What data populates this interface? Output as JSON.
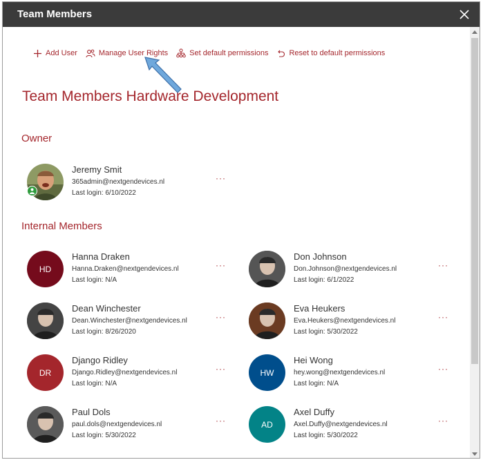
{
  "window": {
    "title": "Team Members"
  },
  "toolbar": {
    "add_user": "Add User",
    "manage_rights": "Manage User Rights",
    "set_default": "Set default permissions",
    "reset_default": "Reset to default permissions"
  },
  "page_title": "Team Members Hardware Development",
  "sections": {
    "owner": "Owner",
    "internal": "Internal Members"
  },
  "owner": {
    "name": "Jeremy Smit",
    "email": "365admin@nextgendevices.nl",
    "last_login": "Last login: 6/10/2022"
  },
  "members": [
    {
      "name": "Hanna Draken",
      "email": "Hanna.Draken@nextgendevices.nl",
      "last_login": "Last login: N/A",
      "initials": "HD",
      "color": "#750b1c"
    },
    {
      "name": "Don Johnson",
      "email": "Don.Johnson@nextgendevices.nl",
      "last_login": "Last login: 6/1/2022",
      "initials": "",
      "color": "#555555"
    },
    {
      "name": "Dean Winchester",
      "email": "Dean.Winchester@nextgendevices.nl",
      "last_login": "Last login: 8/26/2020",
      "initials": "",
      "color": "#444444"
    },
    {
      "name": "Eva Heukers",
      "email": "Eva.Heukers@nextgendevices.nl",
      "last_login": "Last login: 5/30/2022",
      "initials": "",
      "color": "#6b3b22"
    },
    {
      "name": "Django Ridley",
      "email": "Django.Ridley@nextgendevices.nl",
      "last_login": "Last login: N/A",
      "initials": "DR",
      "color": "#a4262c"
    },
    {
      "name": "Hei Wong",
      "email": "hey.wong@nextgendevices.nl",
      "last_login": "Last login: N/A",
      "initials": "HW",
      "color": "#004e8c"
    },
    {
      "name": "Paul Dols",
      "email": "paul.dols@nextgendevices.nl",
      "last_login": "Last login: 5/30/2022",
      "initials": "",
      "color": "#5a5a5a"
    },
    {
      "name": "Axel Duffy",
      "email": "Axel.Duffy@nextgendevices.nl",
      "last_login": "Last login: 5/30/2022",
      "initials": "AD",
      "color": "#038387"
    }
  ],
  "more_label": "···",
  "colors": {
    "accent": "#a4262c",
    "titlebar": "#3b3b3b"
  }
}
